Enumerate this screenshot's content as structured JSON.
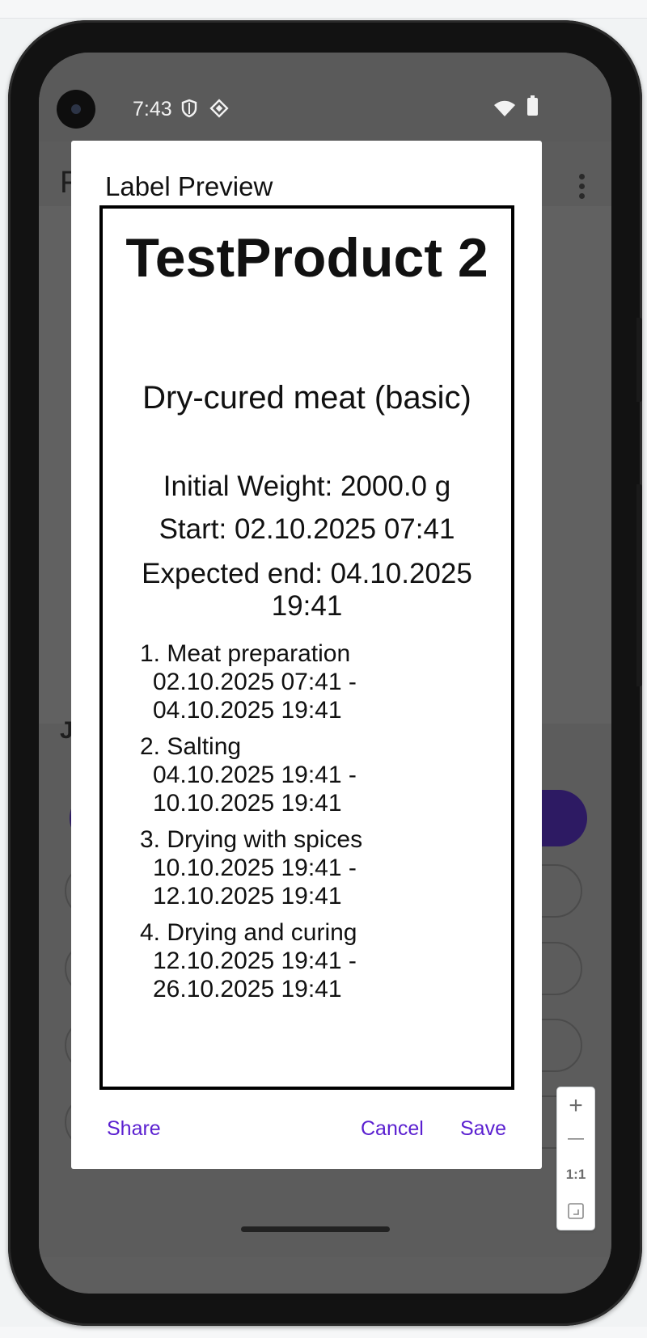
{
  "status_bar": {
    "time": "7:43"
  },
  "app_behind": {
    "title_peek": "F",
    "section_peek": "J"
  },
  "dialog": {
    "title": "Label Preview",
    "label": {
      "product_name": "TestProduct 2",
      "recipe": "Dry-cured meat (basic)",
      "initial_weight": "Initial Weight: 2000.0 g",
      "start": "Start: 02.10.2025 07:41",
      "expected_end": "Expected end: 04.10.2025 19:41",
      "steps": [
        {
          "name": "1. Meat preparation",
          "range_start": "02.10.2025 07:41 -",
          "range_end": "04.10.2025 19:41"
        },
        {
          "name": "2. Salting",
          "range_start": "04.10.2025 19:41 -",
          "range_end": "10.10.2025 19:41"
        },
        {
          "name": "3. Drying with spices",
          "range_start": "10.10.2025 19:41 -",
          "range_end": "12.10.2025 19:41"
        },
        {
          "name": "4. Drying and curing",
          "range_start": "12.10.2025 19:41 -",
          "range_end": "26.10.2025 19:41"
        }
      ]
    },
    "buttons": {
      "share": "Share",
      "cancel": "Cancel",
      "save": "Save"
    }
  },
  "zoom_controls": {
    "zoom_in": "+",
    "zoom_out": "—",
    "reset": "1:1"
  },
  "colors": {
    "accent": "#5a1fd0",
    "scrim": "#5e5e5e",
    "primary_peek": "#2d1a63"
  }
}
